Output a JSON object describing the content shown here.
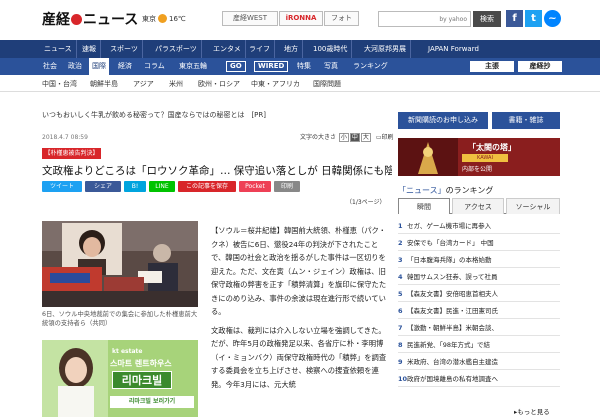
{
  "header": {
    "logo_left": "産経",
    "logo_right": "ニュース",
    "weather_city": "東京",
    "weather_temp": "16℃",
    "buttons": [
      "産経WEST",
      "iRONNA",
      "フォト"
    ],
    "search_placeholder": "by yahoo",
    "search_button": "検索",
    "social": [
      {
        "icon": "facebook-icon",
        "glyph": "f",
        "color": "#3b5998"
      },
      {
        "icon": "twitter-icon",
        "glyph": "t",
        "color": "#1da1f2"
      },
      {
        "icon": "messenger-icon",
        "glyph": "~",
        "color": "#0084ff"
      }
    ]
  },
  "nav_primary": [
    "ニュース",
    "速報",
    "スポーツ",
    "パラスポーツ",
    "エンタメ",
    "ライフ",
    "地方",
    "100歳時代",
    "大河原邦男展",
    "JAPAN Forward"
  ],
  "nav_secondary": [
    "社会",
    "政治",
    "国際",
    "経済",
    "コラム",
    "東京五輪",
    "GO",
    "WIRED",
    "特集",
    "写真",
    "ランキング"
  ],
  "nav_secondary_active": "国際",
  "nav_secondary_ads": [
    "主張",
    "産経抄"
  ],
  "nav_tertiary": [
    "中国・台湾",
    "朝鮮半島",
    "アジア",
    "米州",
    "欧州・ロシア",
    "中東・アフリカ",
    "国際問題"
  ],
  "article": {
    "promo": "いつもおいしく牛乳が飲める秘密って？国産ならではの秘密とは　[PR]",
    "date": "2018.4.7 08:59",
    "font_size_label": "文字の大きさ",
    "font_sizes": [
      "小",
      "中",
      "大"
    ],
    "print_label": "印刷",
    "tag": "【朴槿恵被告判決】",
    "headline": "文政権よりどころは「ロウソク革命」… 保守追い落としが 日韓関係にも陰",
    "share_buttons": [
      "ツイート",
      "シェア",
      "B!",
      "LINE",
      "この記事を保存",
      "Pocket",
      "印刷"
    ],
    "pager": "（1/3ページ）",
    "photo_caption": "6日、ソウル中央地裁前での集会に参加した朴槿恵前大統領の支持者ら（共同）",
    "paragraphs": [
      "【ソウル＝桜井紀雄】韓国前大統領、朴槿恵（パク・クネ）被告に6日、懲役24年の判決が下されたことで、韓国の社会と政治を揺るがした事件は一区切りを迎えた。ただ、文在寅（ムン・ジェイン）政権は、旧保守政権の弊害を正す「積弊清算」を旗印に保守たたきにのめり込み、事件の余波は現在進行形で続いている。",
      "文政権は、裁判には介入しない立場を強調してきた。だが、昨年5月の政権発足以来、各省庁に朴・李明博（イ・ミョンバク）両保守政権時代の「積弊」を調査する委員会を立ち上げさせ、検察への捜査依頼を連発。今年3月には、元大統"
    ]
  },
  "ad_left": {
    "line1": "kt estate",
    "line2": "스마트 렌트하우스",
    "line3": "리마크빌",
    "line4": "리마크빌 보러가기"
  },
  "sidebar": {
    "button_left": "新聞購読のお申し込み",
    "button_right": "書籍・雑誌",
    "ad_line1": "「太閤の塔」",
    "ad_line2": "KAWAI",
    "ad_line3": "内部を公開",
    "ranking_title_q": "「ニュース」",
    "ranking_title": "のランキング",
    "ranking_tabs": [
      "瞬間",
      "アクセス",
      "ソーシャル"
    ],
    "ranking_items": [
      "セガ、ゲーム機市場に再参入",
      "安保でも「台湾カード」 中国",
      "「日本腹海兵隊」の本格始動",
      "韓国サムスン狂券、誤って社員",
      "【森友文書】安倍昭恵首相夫人",
      "【森友文書】民進・江田憲司氏",
      "【激動・朝鮮半島】米朝会談、",
      "民進新党、「98年方式」で結",
      "米政府、台湾の潜水艦自主建造",
      "政府が国境離島の私有地調査へ"
    ],
    "more": "もっと見る"
  }
}
